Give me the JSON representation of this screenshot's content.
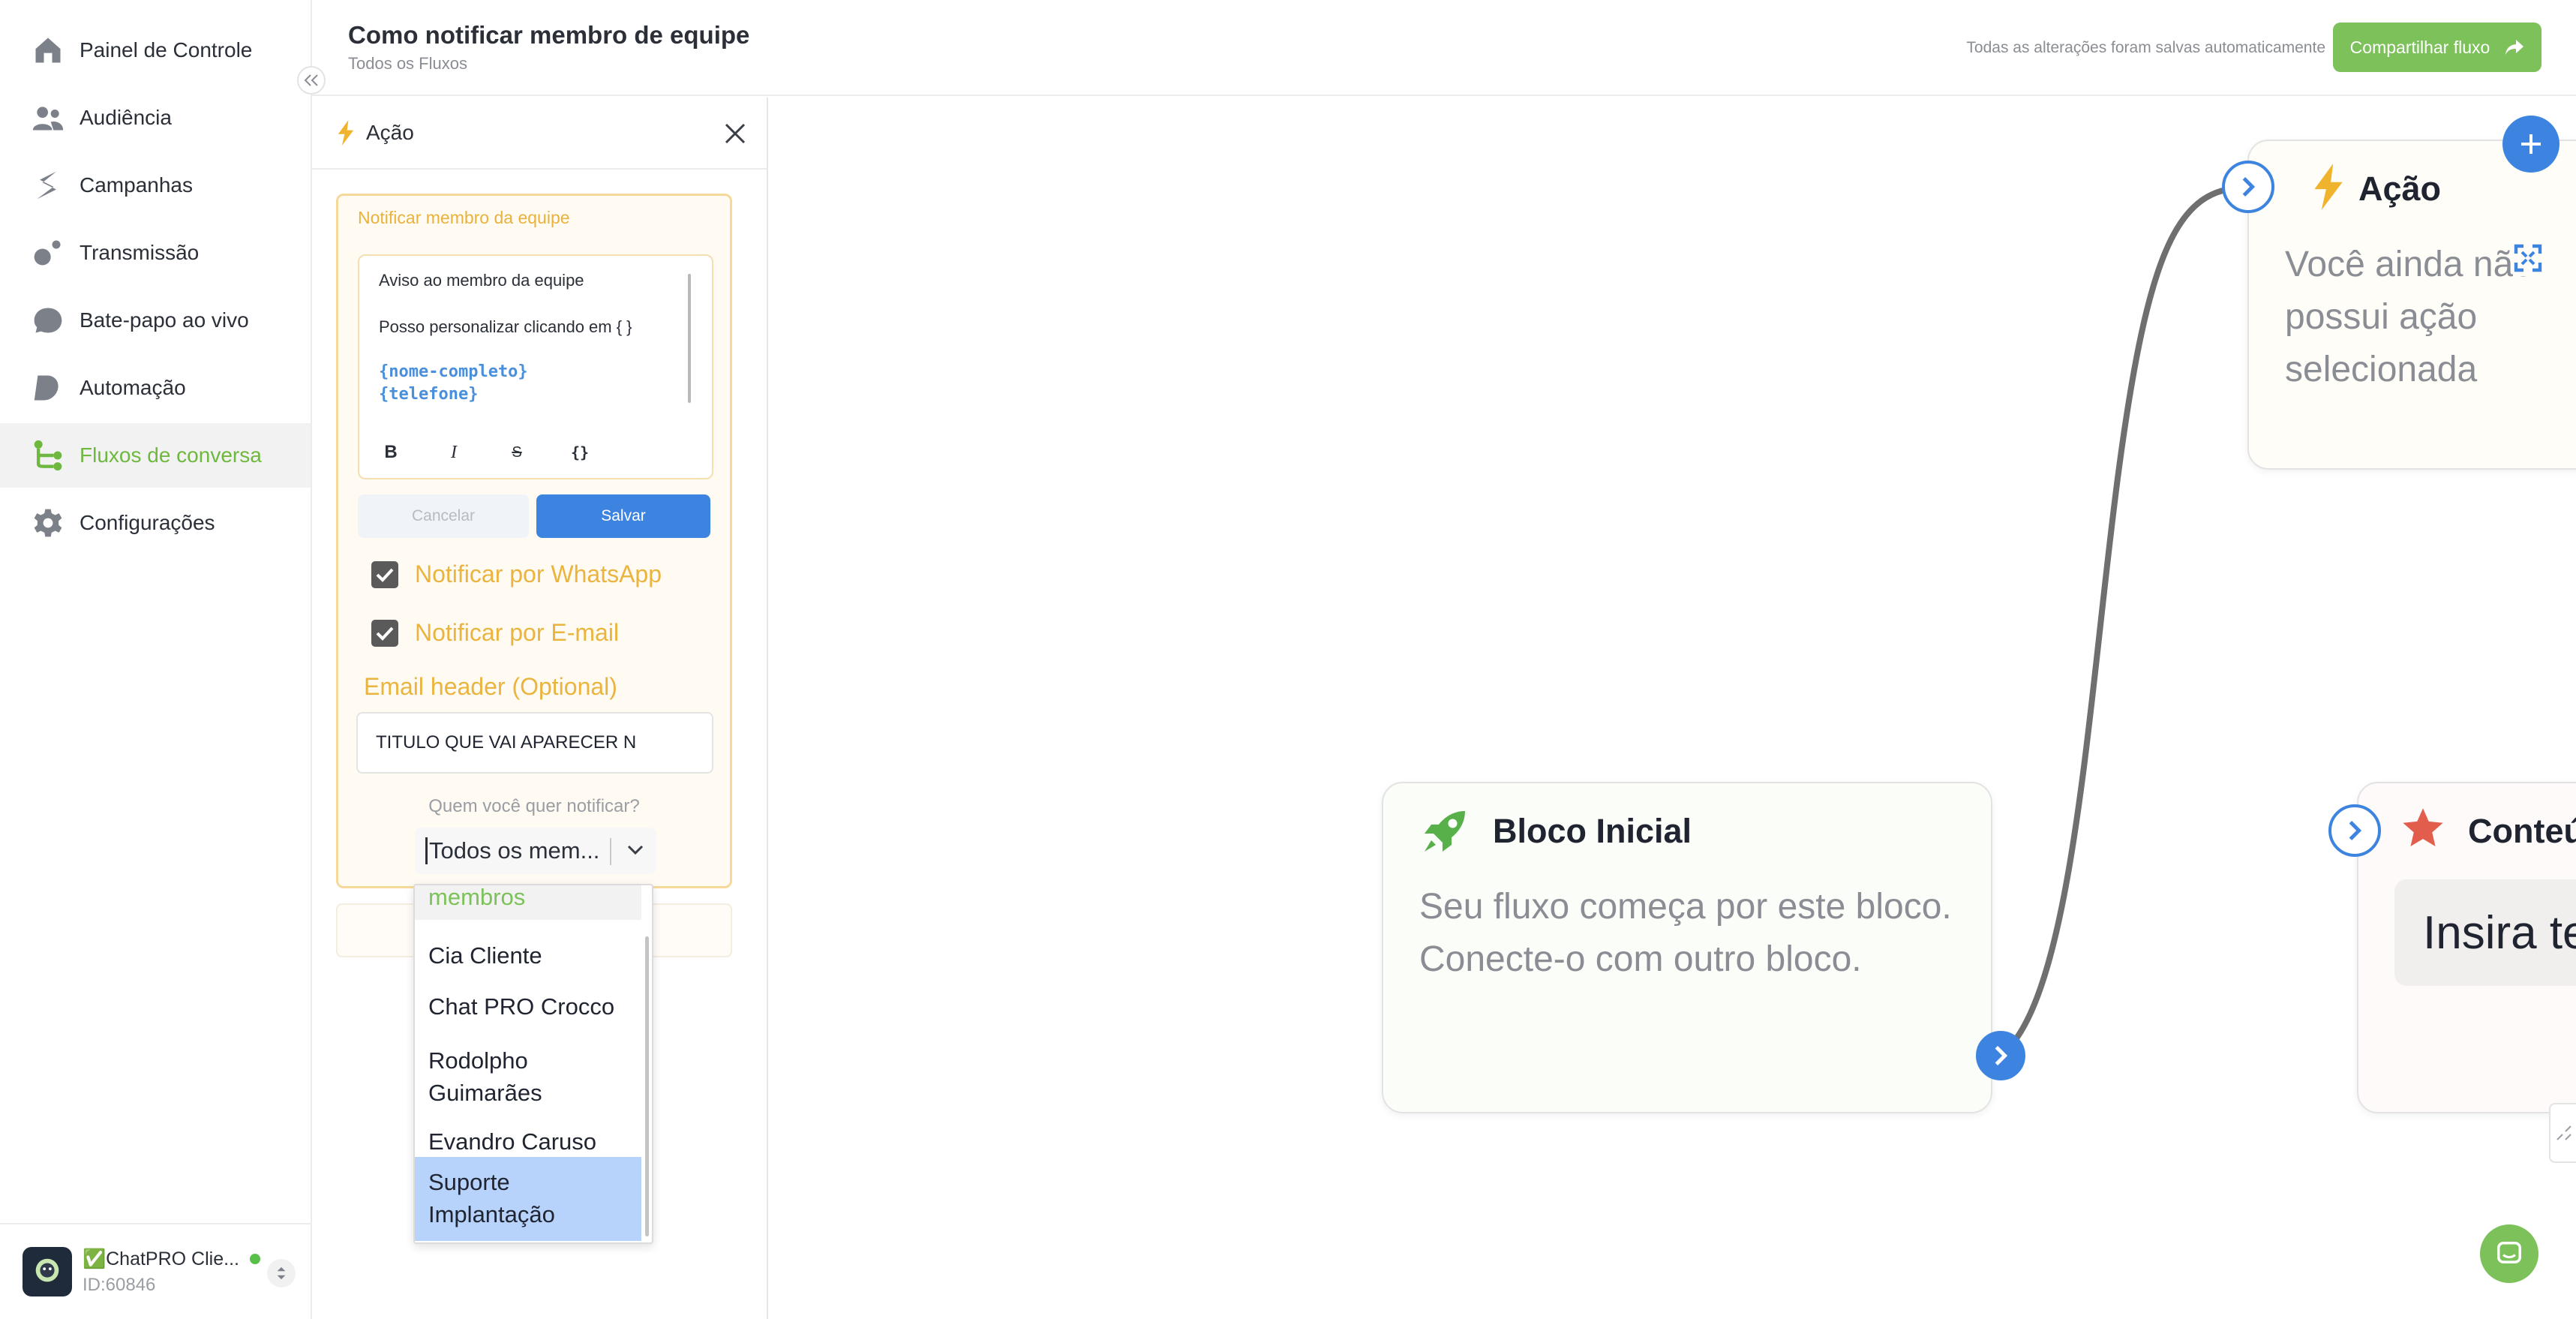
{
  "sidebar": {
    "items": [
      {
        "label": "Painel de Controle",
        "icon": "home-icon"
      },
      {
        "label": "Audiência",
        "icon": "users-icon"
      },
      {
        "label": "Campanhas",
        "icon": "campaign-icon"
      },
      {
        "label": "Transmissão",
        "icon": "broadcast-icon"
      },
      {
        "label": "Bate-papo ao vivo",
        "icon": "chat-bubble-icon"
      },
      {
        "label": "Automação",
        "icon": "automation-icon"
      },
      {
        "label": "Fluxos de conversa",
        "icon": "flow-icon"
      },
      {
        "label": "Configurações",
        "icon": "gear-icon"
      }
    ],
    "active_index": 6,
    "account": {
      "name": "✅ChatPRO Clie...",
      "id": "ID:60846"
    }
  },
  "header": {
    "title": "Como notificar membro de equipe",
    "breadcrumb": "Todos os Fluxos",
    "saved_status": "Todas as alterações foram salvas automaticamente",
    "share_label": "Compartilhar fluxo"
  },
  "panel": {
    "title": "Ação",
    "box_title": "Notificar membro da equipe",
    "editor": {
      "line1": "Aviso ao membro da equipe",
      "line2": "Posso personalizar clicando em { }",
      "var1": "{nome-completo}",
      "var2": "{telefone}",
      "toolbar": {
        "bold": "B",
        "italic": "I",
        "strike": "S",
        "vars": "{}"
      }
    },
    "cancel_label": "Cancelar",
    "save_label": "Salvar",
    "whatsapp_label": "Notificar por WhatsApp",
    "whatsapp_checked": true,
    "email_label": "Notificar por E-mail",
    "email_checked": true,
    "email_header_label": "Email header (Optional)",
    "email_header_value": "TITULO QUE VAI APARECER N",
    "who_label": "Quem você quer notificar?",
    "select_value": "Todos os mem..."
  },
  "dropdown": {
    "partial_item": "membros",
    "options": [
      "Cia Cliente",
      "Chat PRO Crocco",
      "Rodolpho Guimarães",
      "Evandro Caruso",
      "Suporte Implantação"
    ],
    "selected_index": 4
  },
  "canvas": {
    "action_node": {
      "title": "Ação",
      "desc": "Você ainda não possui ação selecionada"
    },
    "start_node": {
      "title": "Bloco Inicial",
      "desc_line1": "Seu fluxo começa por este bloco.",
      "desc_line2": "Conecte-o com outro bloco."
    },
    "content_node": {
      "title": "Conteúdo",
      "input_text": "Insira te"
    }
  },
  "colors": {
    "accent_green": "#7dc15a",
    "primary_blue": "#3d84e0",
    "warning_yellow": "#eab43e"
  }
}
